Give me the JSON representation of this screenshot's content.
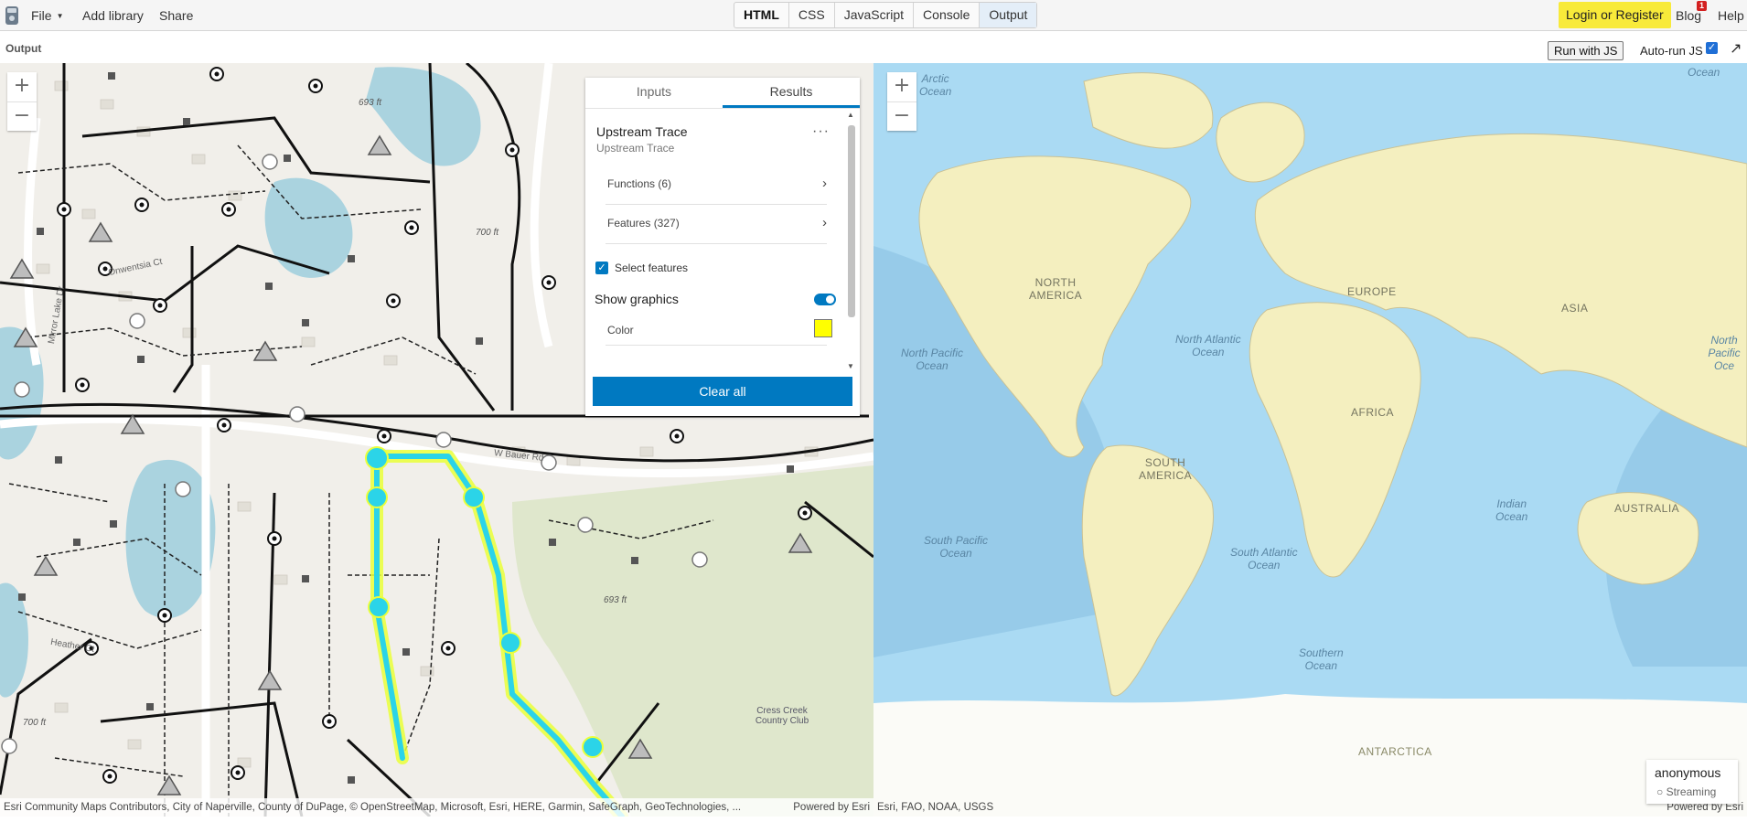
{
  "topbar": {
    "file": "File",
    "add_library": "Add library",
    "share": "Share",
    "tabs": [
      "HTML",
      "CSS",
      "JavaScript",
      "Console",
      "Output"
    ],
    "login": "Login or Register",
    "blog": "Blog",
    "blog_badge": "1",
    "help": "Help"
  },
  "output_bar": {
    "label": "Output",
    "run_button": "Run with JS",
    "auto_run": "Auto-run JS"
  },
  "left_map": {
    "trace_panel": {
      "tabs": [
        "Inputs",
        "Results"
      ],
      "title": "Upstream Trace",
      "subtitle": "Upstream Trace",
      "menu": "···",
      "functions": "Functions (6)",
      "features": "Features (327)",
      "select_features": "Select features",
      "show_graphics": "Show graphics",
      "color_label": "Color",
      "color_value": "#ffff00",
      "clear_all": "Clear all"
    },
    "labels": {
      "elev1": "693 ft",
      "elev2": "693 ft",
      "elev3": "700 ft",
      "elev4": "700 ft",
      "club": "Cress Creek Country Club",
      "road1": "W Bauer Rd",
      "road2": "Heather Ct",
      "road3": "Mirror Lake Dr",
      "road4": "Onwentsia Ct"
    },
    "attribution": "Esri Community Maps Contributors, City of Naperville, County of DuPage, © OpenStreetMap, Microsoft, Esri, HERE, Garmin, SafeGraph, GeoTechnologies, ...",
    "powered": "Powered by Esri"
  },
  "right_map": {
    "oceans": {
      "arctic": "Arctic\nOcean",
      "arctic_right": "Ocean",
      "north_pacific": "North Pacific\nOcean",
      "north_pacific_right": "North Pacific\nOce",
      "north_atlantic": "North Atlantic\nOcean",
      "south_pacific": "South Pacific\nOcean",
      "south_atlantic": "South Atlantic\nOcean",
      "indian": "Indian\nOcean",
      "southern": "Southern\nOcean"
    },
    "continents": {
      "north_america": "NORTH\nAMERICA",
      "south_america": "SOUTH\nAMERICA",
      "europe": "EUROPE",
      "africa": "AFRICA",
      "asia": "ASIA",
      "australia": "AUSTRALIA",
      "antarctica": "ANTARCTICA"
    },
    "attribution": "Esri, FAO, NOAA, USGS",
    "powered": "Powered by Esri",
    "user": {
      "name": "anonymous",
      "status": "Streaming"
    }
  },
  "colors": {
    "accent": "#0079c1",
    "trace_highlight": "#2bd4e8",
    "trace_glow": "#eaff3a",
    "login_bg": "#f8ea3a"
  }
}
